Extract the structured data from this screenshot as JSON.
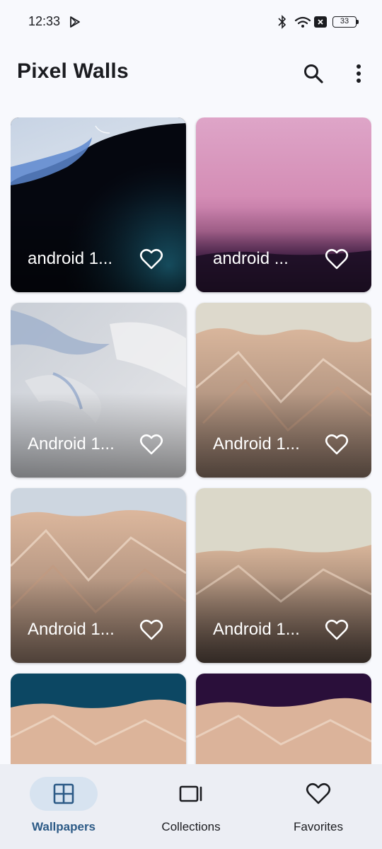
{
  "status_bar": {
    "time": "12:33",
    "battery": "33"
  },
  "app_bar": {
    "title": "Pixel Walls",
    "search_icon": "search-icon",
    "more_icon": "more-vert-icon"
  },
  "wallpapers": [
    {
      "title": "android 1...",
      "favorited": false
    },
    {
      "title": "android ...",
      "favorited": false
    },
    {
      "title": "Android 1...",
      "favorited": false
    },
    {
      "title": "Android 1...",
      "favorited": false
    },
    {
      "title": "Android 1...",
      "favorited": false
    },
    {
      "title": "Android 1...",
      "favorited": false
    },
    {
      "title": "",
      "favorited": false
    },
    {
      "title": "",
      "favorited": false
    }
  ],
  "bottom_nav": {
    "items": [
      {
        "label": "Wallpapers",
        "icon": "grid-icon",
        "active": true
      },
      {
        "label": "Collections",
        "icon": "collections-icon",
        "active": false
      },
      {
        "label": "Favorites",
        "icon": "heart-icon",
        "active": false
      }
    ]
  },
  "colors": {
    "background": "#f8f9fd",
    "accent": "#2c5a86",
    "nav_background": "#eceef4",
    "nav_pill": "#d7e3f0"
  }
}
